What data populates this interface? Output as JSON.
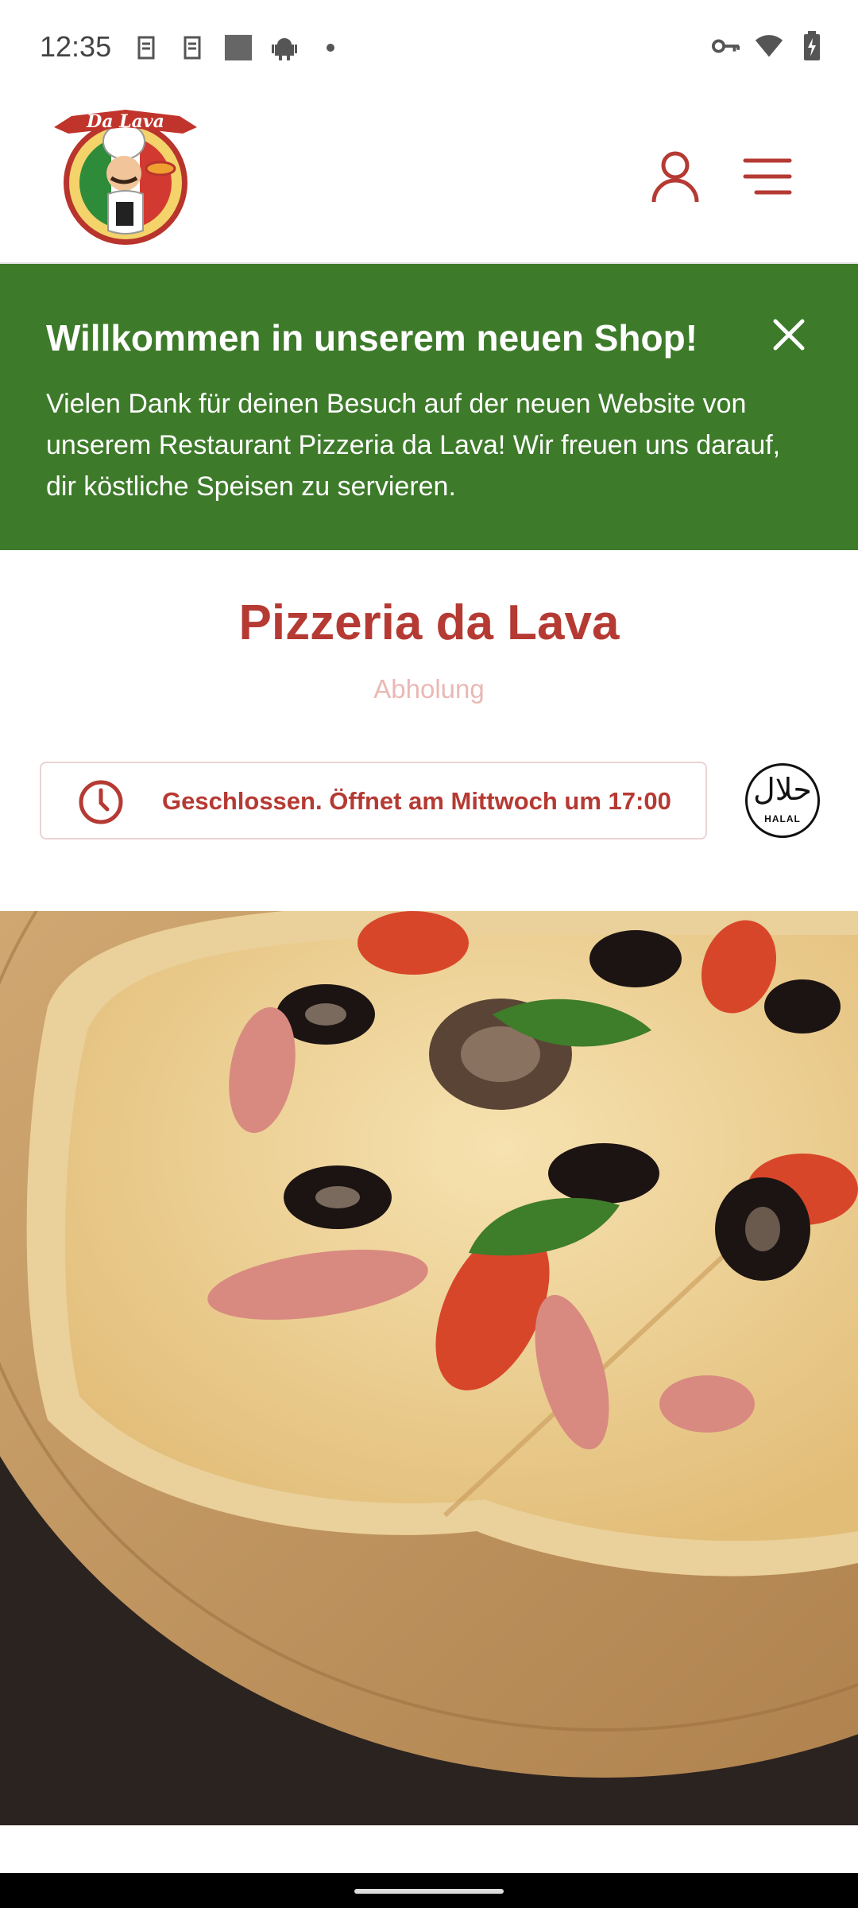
{
  "status_bar": {
    "time": "12:35",
    "left_icons": [
      "sim-icon",
      "sim-icon",
      "image-icon",
      "android-icon",
      "dot-icon"
    ],
    "right_icons": [
      "key-icon",
      "wifi-icon",
      "battery-icon"
    ]
  },
  "header": {
    "logo_text": "Da Lava",
    "user_icon": "user-icon",
    "menu_icon": "hamburger-menu-icon"
  },
  "banner": {
    "title": "Willkommen in unserem neuen Shop!",
    "text": "Vielen Dank für deinen Besuch auf der neuen Website von unserem Restaurant Pizzeria da Lava! Wir freuen uns darauf, dir köstliche Speisen zu servieren.",
    "close_icon": "close-icon",
    "background": "#3d7a2a"
  },
  "restaurant": {
    "name": "Pizzeria da Lava",
    "mode": "Abholung",
    "status": "Geschlossen. Öffnet am Mittwoch um 17:00",
    "halal_arabic": "حلال",
    "halal_label": "HALAL"
  },
  "colors": {
    "brand_red": "#b53a33",
    "banner_green": "#3d7a2a"
  }
}
